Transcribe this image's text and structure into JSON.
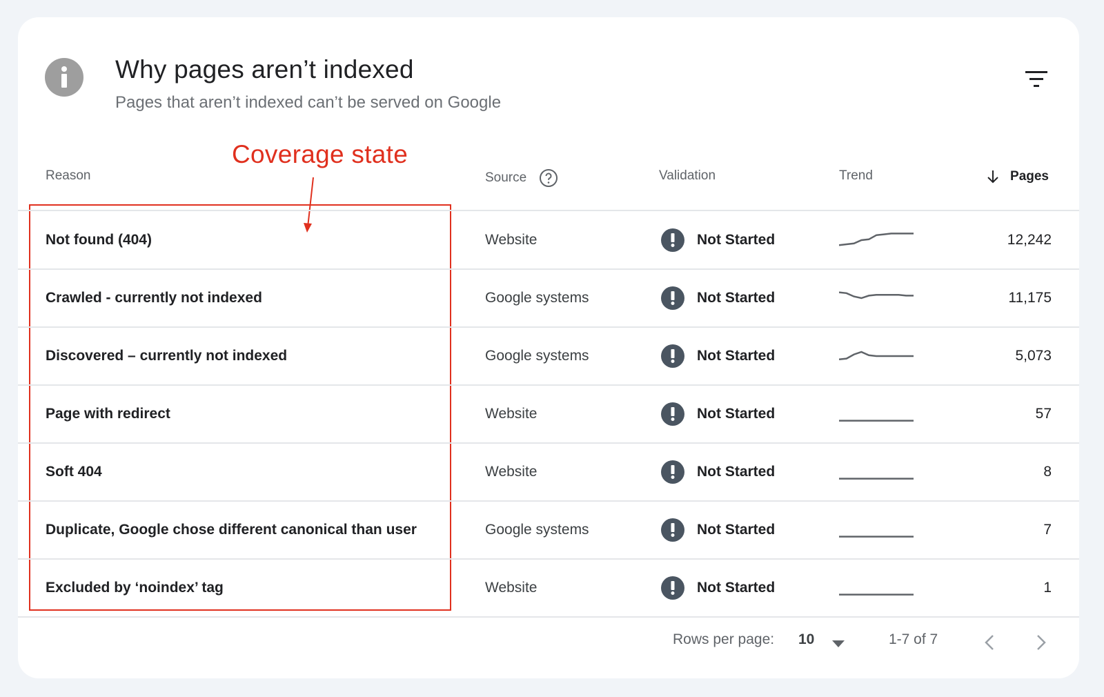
{
  "header": {
    "title": "Why pages aren’t indexed",
    "subtitle": "Pages that aren’t indexed can’t be served on Google"
  },
  "annotation": {
    "label": "Coverage state",
    "color": "#e0301e"
  },
  "table": {
    "columns": {
      "reason": "Reason",
      "source": "Source",
      "validation": "Validation",
      "trend": "Trend",
      "pages": "Pages"
    },
    "rows": [
      {
        "reason": "Not found (404)",
        "source": "Website",
        "validation": "Not Started",
        "pages": "12,242",
        "trend": [
          0.2,
          0.25,
          0.3,
          0.5,
          0.55,
          0.8,
          0.85,
          0.9,
          0.9,
          0.9,
          0.9
        ]
      },
      {
        "reason": "Crawled - currently not indexed",
        "source": "Google systems",
        "validation": "Not Started",
        "pages": "11,175",
        "trend": [
          0.85,
          0.8,
          0.6,
          0.5,
          0.65,
          0.7,
          0.7,
          0.7,
          0.7,
          0.65,
          0.65
        ]
      },
      {
        "reason": "Discovered – currently not indexed",
        "source": "Google systems",
        "validation": "Not Started",
        "pages": "5,073",
        "trend": [
          0.3,
          0.35,
          0.6,
          0.75,
          0.55,
          0.5,
          0.5,
          0.5,
          0.5,
          0.5,
          0.5
        ]
      },
      {
        "reason": "Page with redirect",
        "source": "Website",
        "validation": "Not Started",
        "pages": "57",
        "trend": [
          0.1,
          0.1,
          0.1,
          0.1,
          0.1,
          0.1,
          0.1,
          0.1,
          0.1,
          0.1,
          0.1
        ]
      },
      {
        "reason": "Soft 404",
        "source": "Website",
        "validation": "Not Started",
        "pages": "8",
        "trend": [
          0.1,
          0.1,
          0.1,
          0.1,
          0.1,
          0.1,
          0.1,
          0.1,
          0.1,
          0.1,
          0.1
        ]
      },
      {
        "reason": "Duplicate, Google chose different canonical than user",
        "source": "Google systems",
        "validation": "Not Started",
        "pages": "7",
        "trend": [
          0.1,
          0.1,
          0.1,
          0.1,
          0.1,
          0.1,
          0.1,
          0.1,
          0.1,
          0.1,
          0.1
        ]
      },
      {
        "reason": "Excluded by ‘noindex’ tag",
        "source": "Website",
        "validation": "Not Started",
        "pages": "1",
        "trend": [
          0.1,
          0.1,
          0.1,
          0.1,
          0.1,
          0.1,
          0.1,
          0.1,
          0.1,
          0.1,
          0.1
        ]
      }
    ]
  },
  "footer": {
    "rows_per_page_label": "Rows per page:",
    "rows_per_page_value": "10",
    "range": "1-7 of 7"
  },
  "icons": {
    "info": "info-icon",
    "filter": "filter-icon",
    "help": "help-icon",
    "sort": "arrow-down-icon",
    "warning": "exclamation-icon",
    "caret": "caret-down-icon",
    "prev": "chevron-left-icon",
    "next": "chevron-right-icon"
  },
  "colors": {
    "background": "#f1f4f8",
    "card": "#ffffff",
    "warning_icon": "#4a5561",
    "info_icon": "#9e9e9e",
    "trend_line": "#5f6368"
  }
}
